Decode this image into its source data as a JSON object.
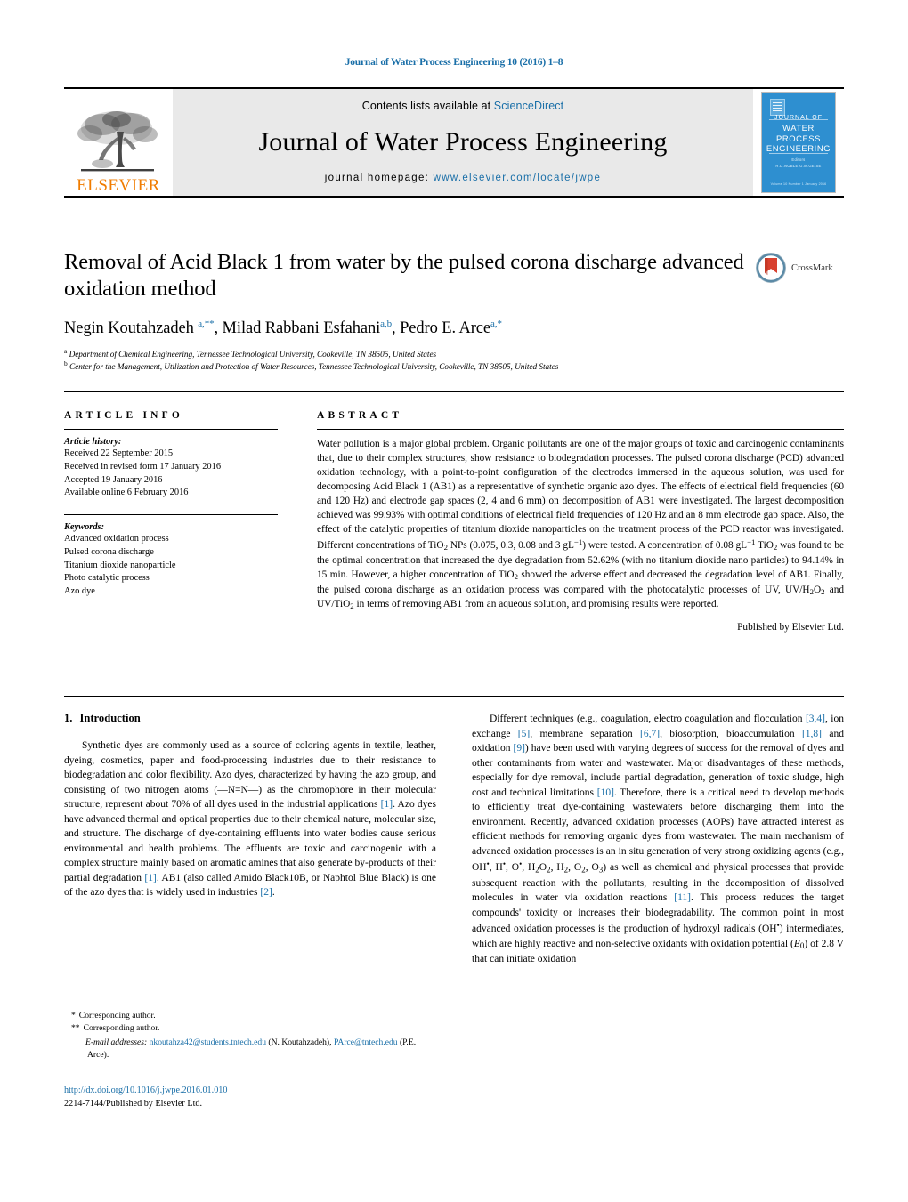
{
  "running_head": "Journal of Water Process Engineering 10 (2016) 1–8",
  "masthead": {
    "contents_prefix": "Contents lists available at ",
    "sciencedirect": "ScienceDirect",
    "journal_title": "Journal of Water Process Engineering",
    "homepage_label": "journal homepage:",
    "homepage_url": "www.elsevier.com/locate/jwpe",
    "publisher_logo_text": "ELSEVIER",
    "publisher_logo_icon": "elsevier-tree-icon",
    "cover": {
      "line1": "JOURNAL OF",
      "line2": "WATER PROCESS",
      "line3": "ENGINEERING",
      "meta1": "Editors",
      "meta2": "R.D.NOBLE     G.M.GEISE",
      "footer": "Volume 10   Number 1  January 2016"
    }
  },
  "article": {
    "title": "Removal of Acid Black 1 from water by the pulsed corona discharge advanced oxidation method",
    "crossmark_label": "CrossMark",
    "authors_html": "Negin Koutahzadeh <sup>a,**</sup>, Milad Rabbani Esfahani<sup>a,b</sup>, Pedro E. Arce<sup>a,*</sup>",
    "affiliations": [
      {
        "marker": "a",
        "text": "Department of Chemical Engineering, Tennessee Technological University, Cookeville, TN 38505, United States"
      },
      {
        "marker": "b",
        "text": "Center for the Management, Utilization and Protection of Water Resources, Tennessee Technological University, Cookeville, TN 38505, United States"
      }
    ]
  },
  "article_info": {
    "heading": "ARTICLE INFO",
    "history_label": "Article history:",
    "history": [
      "Received 22 September 2015",
      "Received in revised form 17 January 2016",
      "Accepted 19 January 2016",
      "Available online 6 February 2016"
    ],
    "keywords_label": "Keywords:",
    "keywords": [
      "Advanced oxidation process",
      "Pulsed corona discharge",
      "Titanium dioxide nanoparticle",
      "Photo catalytic process",
      "Azo dye"
    ]
  },
  "abstract": {
    "heading": "ABSTRACT",
    "body_html": "Water pollution is a major global problem. Organic pollutants are one of the major groups of toxic and carcinogenic contaminants that, due to their complex structures, show resistance to biodegradation processes. The pulsed corona discharge (PCD) advanced oxidation technology, with a point-to-point configuration of the electrodes immersed in the aqueous solution, was used for decomposing Acid Black 1 (AB1) as a representative of synthetic organic azo dyes. The effects of electrical field frequencies (60 and 120 Hz) and electrode gap spaces (2, 4 and 6 mm) on decomposition of AB1 were investigated. The largest decomposition achieved was 99.93% with optimal conditions of electrical field frequencies of 120 Hz and an 8 mm electrode gap space. Also, the effect of the catalytic properties of titanium dioxide nanoparticles on the treatment process of the PCD reactor was investigated. Different concentrations of TiO<span class=\"sub\">2</span> NPs (0.075, 0.3, 0.08 and 3 gL<span class=\"sup\">−1</span>) were tested. A concentration of 0.08 gL<span class=\"sup\">−1</span> TiO<span class=\"sub\">2</span> was found to be the optimal concentration that increased the dye degradation from 52.62% (with no titanium dioxide nano particles) to 94.14% in 15 min. However, a higher concentration of TiO<span class=\"sub\">2</span> showed the adverse effect and decreased the degradation level of AB1. Finally, the pulsed corona discharge as an oxidation process was compared with the photocatalytic processes of UV, UV/H<span class=\"sub\">2</span>O<span class=\"sub\">2</span> and UV/TiO<span class=\"sub\">2</span> in terms of removing AB1 from an aqueous solution, and promising results were reported.",
    "signature": "Published by Elsevier Ltd."
  },
  "introduction": {
    "number": "1.",
    "heading": "Introduction",
    "left_html": "Synthetic dyes are commonly used as a source of coloring agents in textile, leather, dyeing, cosmetics, paper and food-processing industries due to their resistance to biodegradation and color flexibility. Azo dyes, characterized by having the azo group, and consisting of two nitrogen atoms (—N=N—) as the chromophore in their molecular structure, represent about 70% of all dyes used in the industrial applications <span class=\"ref\">[1]</span>. Azo dyes have advanced thermal and optical properties due to their chemical nature, molecular size, and structure. The discharge of dye-containing effluents into water bodies cause serious environmental and health problems. The effluents are toxic and carcinogenic with a complex structure mainly based on aromatic amines that also generate by-products of their partial degradation <span class=\"ref\">[1]</span>. AB1 (also called Amido Black10B, or Naphtol Blue Black) is one of the azo dyes that is widely used in industries <span class=\"ref\">[2]</span>.",
    "right_html": "Different techniques (e.g., coagulation, electro coagulation and flocculation <span class=\"ref\">[3,4]</span>, ion exchange <span class=\"ref\">[5]</span>, membrane separation <span class=\"ref\">[6,7]</span>, biosorption, bioaccumulation <span class=\"ref\">[1,8]</span> and oxidation <span class=\"ref\">[9]</span>) have been used with varying degrees of success for the removal of dyes and other contaminants from water and wastewater. Major disadvantages of these methods, especially for dye removal, include partial degradation, generation of toxic sludge, high cost and technical limitations <span class=\"ref\">[10]</span>. Therefore, there is a critical need to develop methods to efficiently treat dye-containing wastewaters before discharging them into the environment. Recently, advanced oxidation processes (AOPs) have attracted interest as efficient methods for removing organic dyes from wastewater. The main mechanism of advanced oxidation processes is an in situ generation of very strong oxidizing agents (e.g., OH<span class=\"sup\">•</span>, H<span class=\"sup\">•</span>, O<span class=\"sup\">•</span>, H<span class=\"sub\">2</span>O<span class=\"sub\">2</span>, H<span class=\"sub\">2</span>, O<span class=\"sub\">2</span>, O<span class=\"sub\">3</span>) as well as chemical and physical processes that provide subsequent reaction with the pollutants, resulting in the decomposition of dissolved molecules in water via oxidation reactions <span class=\"ref\">[11]</span>. This process reduces the target compounds' toxicity or increases their biodegradability. The common point in most advanced oxidation processes is the production of hydroxyl radicals (OH<span class=\"sup\">•</span>) intermediates, which are highly reactive and non-selective oxidants with oxidation potential (<i>E</i><span class=\"sub\">0</span>) of 2.8 V that can initiate oxidation"
  },
  "footnotes": {
    "corresponding_1": "Corresponding author.",
    "corresponding_2": "Corresponding author.",
    "star_1": "*",
    "star_2": "**",
    "email_label": "E-mail addresses:",
    "email_1": "nkoutahza42@students.tntech.edu",
    "email_1_name": "(N. Koutahzadeh),",
    "email_2": "PArce@tntech.edu",
    "email_2_name": "(P.E. Arce)."
  },
  "doi": {
    "url": "http://dx.doi.org/10.1016/j.jwpe.2016.01.010",
    "issn": "2214-7144/Published by Elsevier Ltd."
  },
  "colors": {
    "link": "#1a6fa8",
    "elsevier_orange": "#F07C00",
    "cover_blue": "#2e8fd0",
    "band_grey": "#e9e9e9"
  }
}
